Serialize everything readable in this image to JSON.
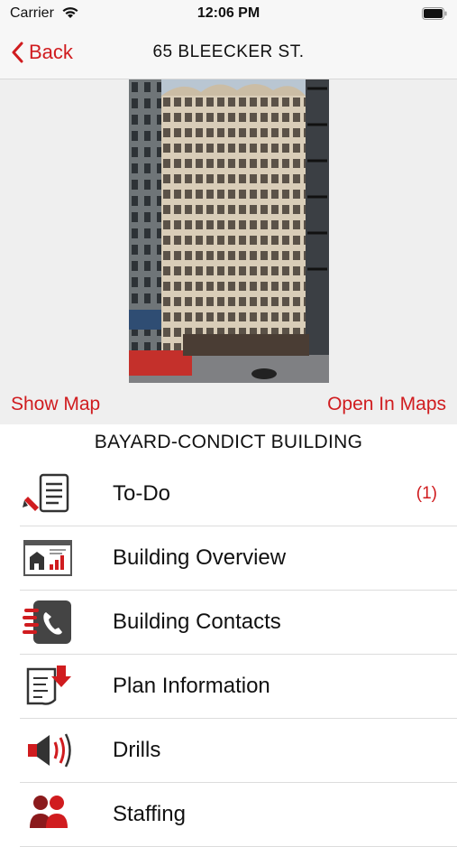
{
  "status_bar": {
    "carrier": "Carrier",
    "time": "12:06 PM"
  },
  "nav": {
    "back_label": "Back",
    "title": "65 BLEECKER ST."
  },
  "hero": {
    "show_map": "Show Map",
    "open_in_maps": "Open In Maps"
  },
  "building_name": "BAYARD-CONDICT BUILDING",
  "menu": [
    {
      "label": "To-Do",
      "badge": "(1)",
      "icon": "todo-checklist-icon"
    },
    {
      "label": "Building Overview",
      "badge": "",
      "icon": "building-overview-icon"
    },
    {
      "label": "Building Contacts",
      "badge": "",
      "icon": "phone-contacts-icon"
    },
    {
      "label": "Plan Information",
      "badge": "",
      "icon": "plan-download-icon"
    },
    {
      "label": "Drills",
      "badge": "",
      "icon": "megaphone-icon"
    },
    {
      "label": "Staffing",
      "badge": "",
      "icon": "people-icon"
    }
  ],
  "colors": {
    "accent": "#d01c1f",
    "nav_background": "#f7f7f7",
    "hero_background": "#efefef"
  }
}
